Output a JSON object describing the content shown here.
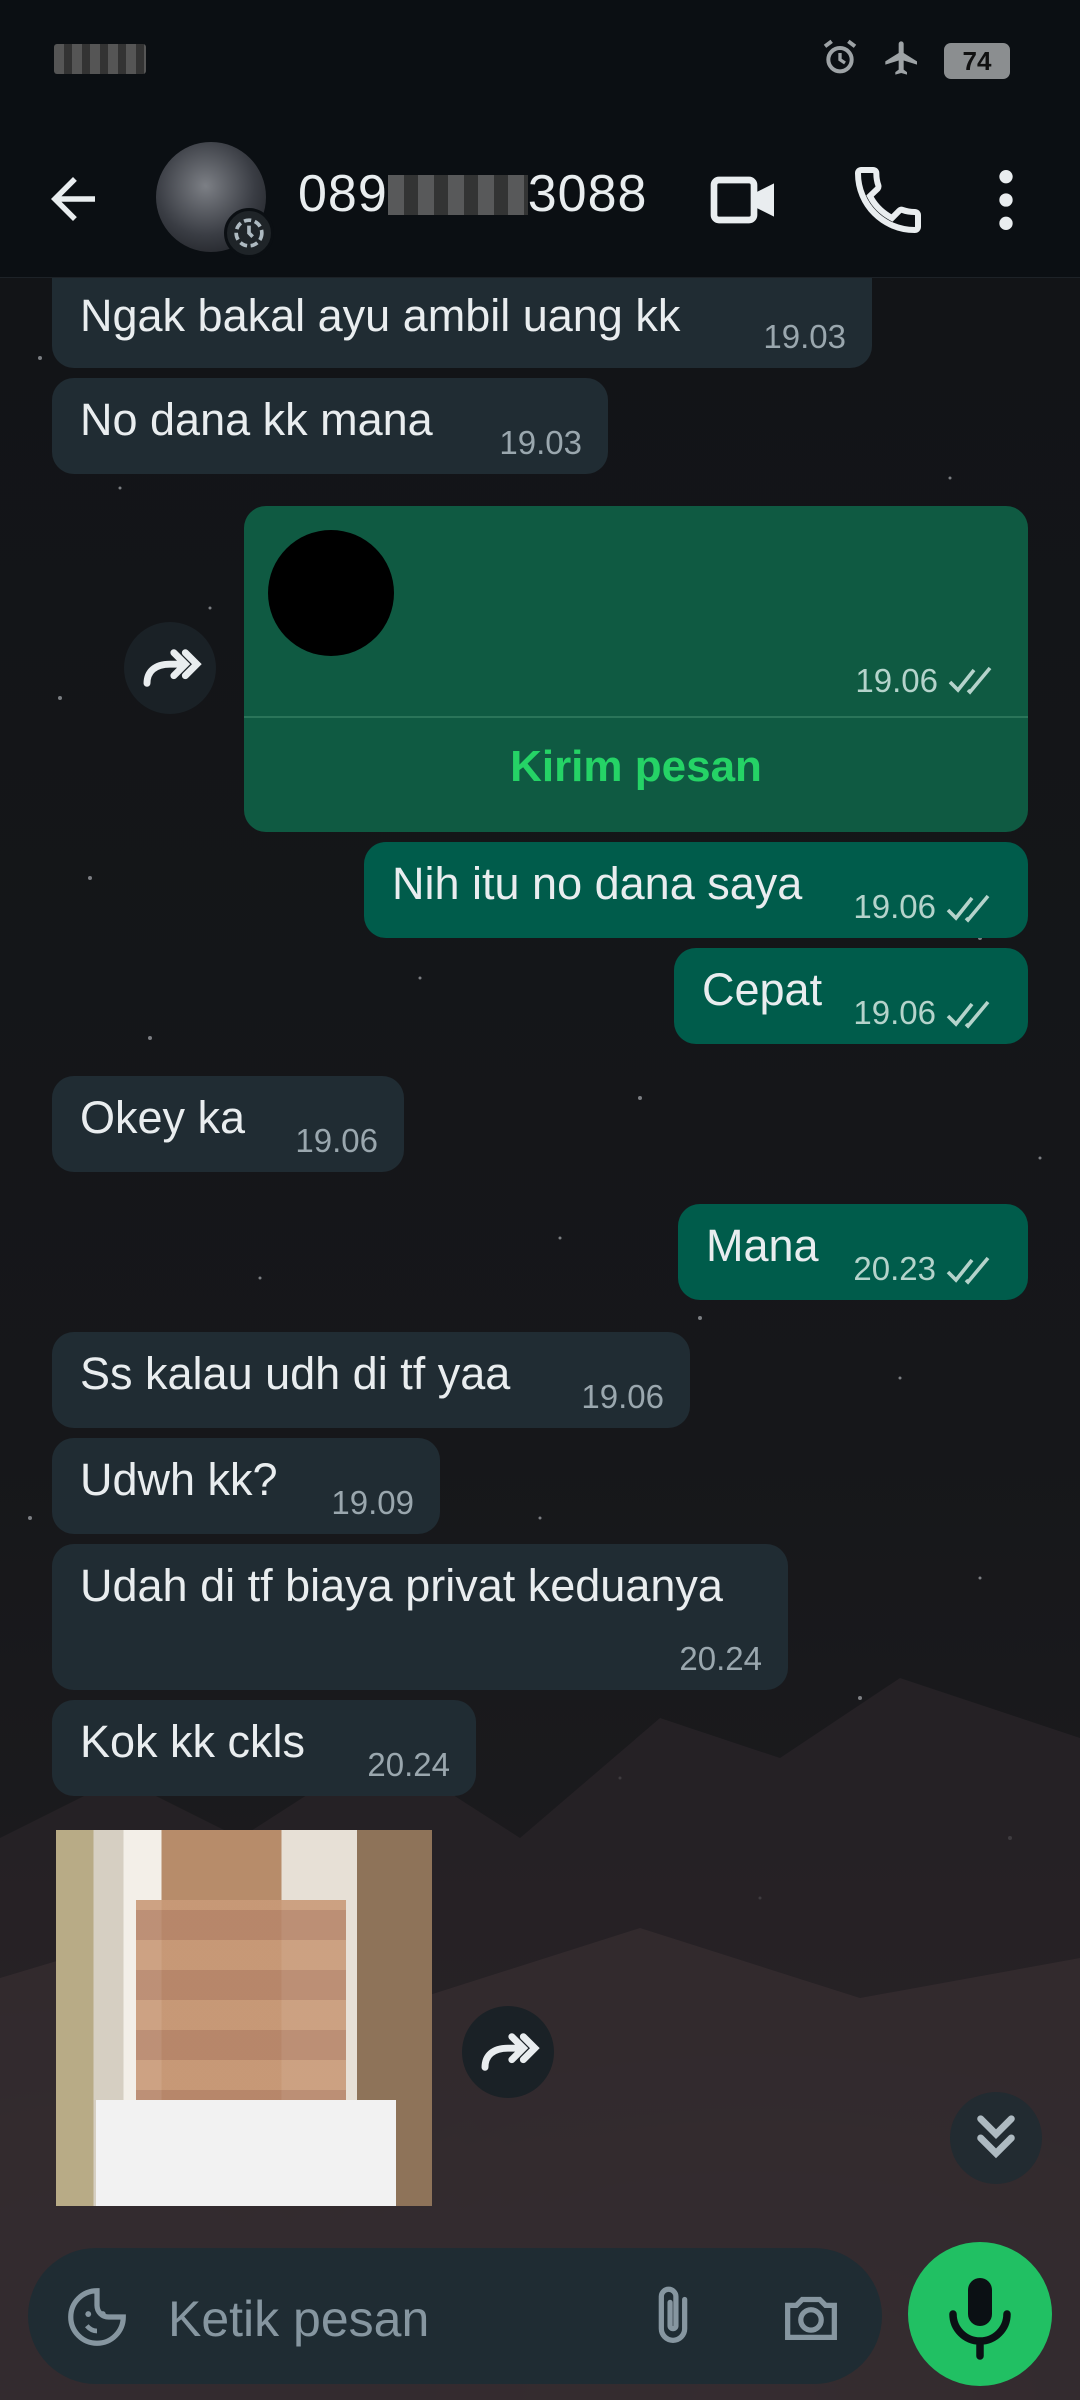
{
  "status_bar": {
    "battery_level": "74"
  },
  "header": {
    "contact_prefix": "089",
    "contact_suffix": "3088"
  },
  "messages": [
    {
      "direction": "in",
      "text": "Ngak bakal ayu ambil uang kk",
      "time": "19.03"
    },
    {
      "direction": "in",
      "text": "No dana kk mana",
      "time": "19.03"
    },
    {
      "direction": "out",
      "type": "contact_card",
      "time": "19.06",
      "action": "Kirim pesan"
    },
    {
      "direction": "out",
      "text": "Nih itu no dana saya",
      "time": "19.06"
    },
    {
      "direction": "out",
      "text": "Cepat",
      "time": "19.06"
    },
    {
      "direction": "in",
      "text": "Okey ka",
      "time": "19.06"
    },
    {
      "direction": "out",
      "text": "Mana",
      "time": "20.23"
    },
    {
      "direction": "in",
      "text": "Ss kalau udh di tf yaa",
      "time": "19.06"
    },
    {
      "direction": "in",
      "text": "Udwh kk?",
      "time": "19.09"
    },
    {
      "direction": "in",
      "text": "Udah di tf biaya privat keduanya",
      "time": "20.24"
    },
    {
      "direction": "in",
      "text": "Kok kk ckls",
      "time": "20.24"
    },
    {
      "direction": "in",
      "type": "image"
    }
  ],
  "input": {
    "placeholder": "Ketik pesan"
  },
  "colors": {
    "incoming_bubble": "#202c33",
    "outgoing_bubble": "#005c4b",
    "accent": "#25d366",
    "mic_button": "#21c063"
  },
  "icons": [
    "back-arrow-icon",
    "video-call-icon",
    "voice-call-icon",
    "more-options-icon",
    "forward-icon",
    "sticker-icon",
    "attach-icon",
    "camera-icon",
    "mic-icon",
    "double-chevron-down-icon",
    "alarm-icon",
    "airplane-icon"
  ]
}
